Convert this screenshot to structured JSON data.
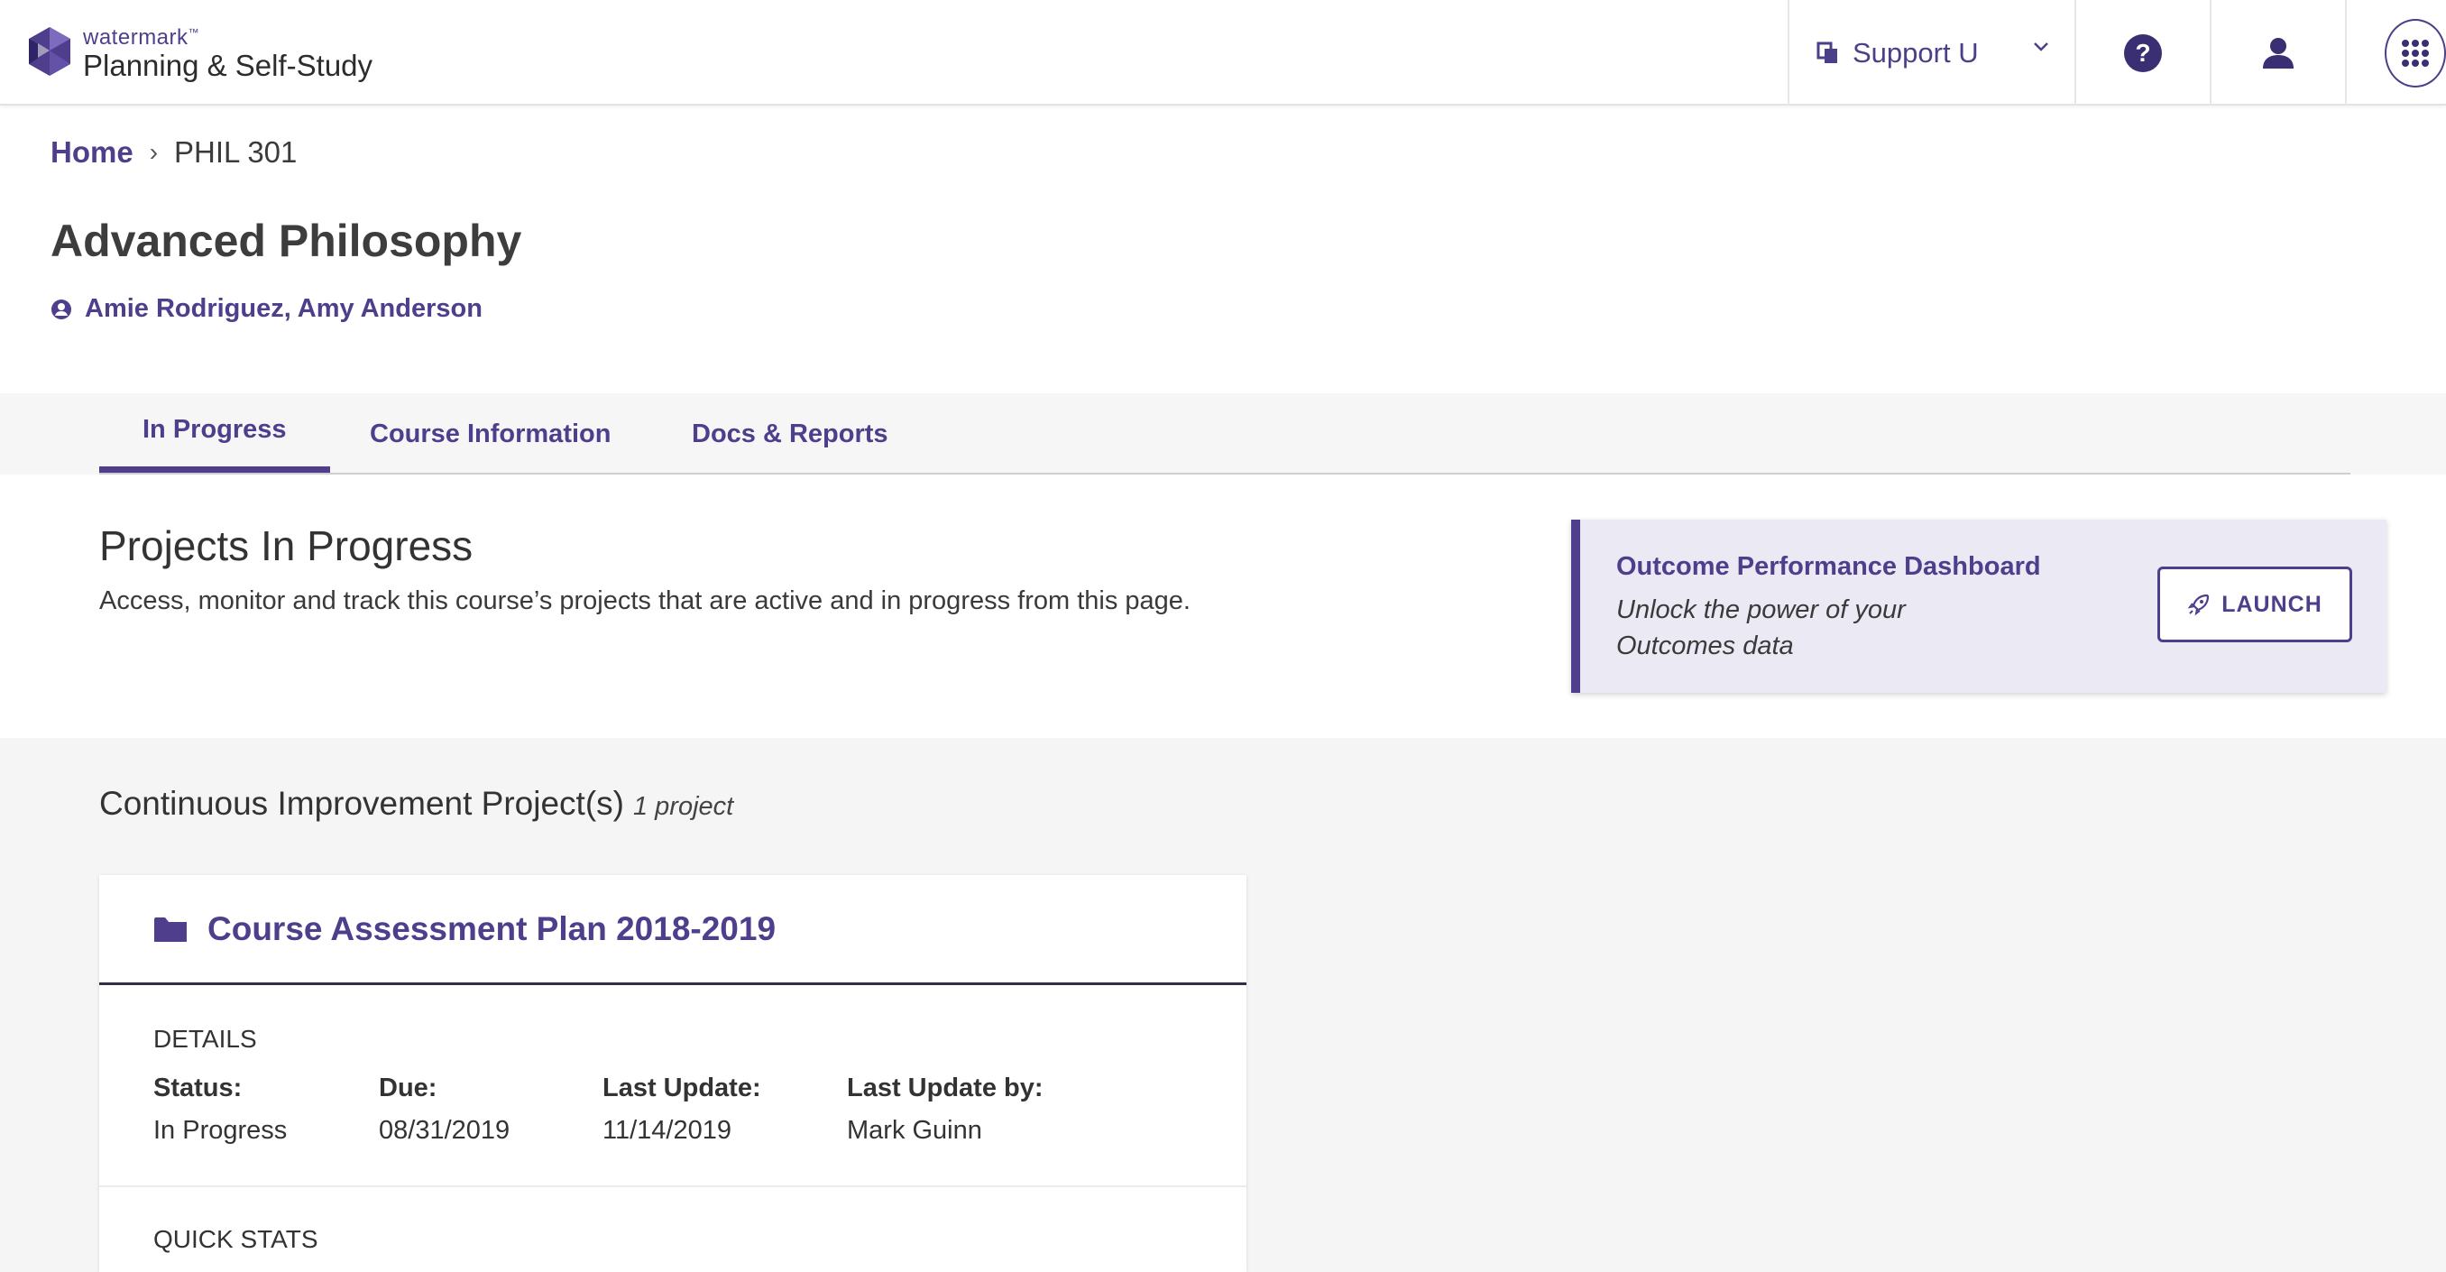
{
  "app": {
    "brand": "watermark",
    "brand_mark": "™",
    "product": "Planning & Self-Study"
  },
  "topbar": {
    "org_label": "Support U",
    "icons": [
      "copy-icon",
      "chevron-down-icon",
      "help-icon",
      "user-icon",
      "apps-grid-icon"
    ]
  },
  "breadcrumb": {
    "home": "Home",
    "separator": "›",
    "current": "PHIL 301"
  },
  "page": {
    "title": "Advanced Philosophy",
    "instructors": "Amie Rodriguez, Amy Anderson"
  },
  "tabs": [
    {
      "label": "In Progress",
      "active": true
    },
    {
      "label": "Course Information",
      "active": false
    },
    {
      "label": "Docs & Reports",
      "active": false
    }
  ],
  "section": {
    "title": "Projects In Progress",
    "description": "Access, monitor and track this course’s projects that are active and in progress from this page."
  },
  "dashboard": {
    "title": "Outcome Performance Dashboard",
    "subtitle": "Unlock the power of your Outcomes data",
    "button_label": "LAUNCH"
  },
  "group": {
    "title": "Continuous Improvement Project(s)",
    "count": "1 project"
  },
  "project": {
    "name": "Course Assessment Plan 2018-2019",
    "details_label": "DETAILS",
    "details": [
      {
        "key": "Status:",
        "value": "In Progress"
      },
      {
        "key": "Due:",
        "value": "08/31/2019"
      },
      {
        "key": "Last Update:",
        "value": "11/14/2019"
      },
      {
        "key": "Last Update by:",
        "value": "Mark Guinn"
      }
    ],
    "quick_stats_label": "QUICK STATS"
  },
  "colors": {
    "brand": "#4e3e8c",
    "dashboard_bg": "#ebe9f4",
    "lower_bg": "#f5f5f5"
  }
}
